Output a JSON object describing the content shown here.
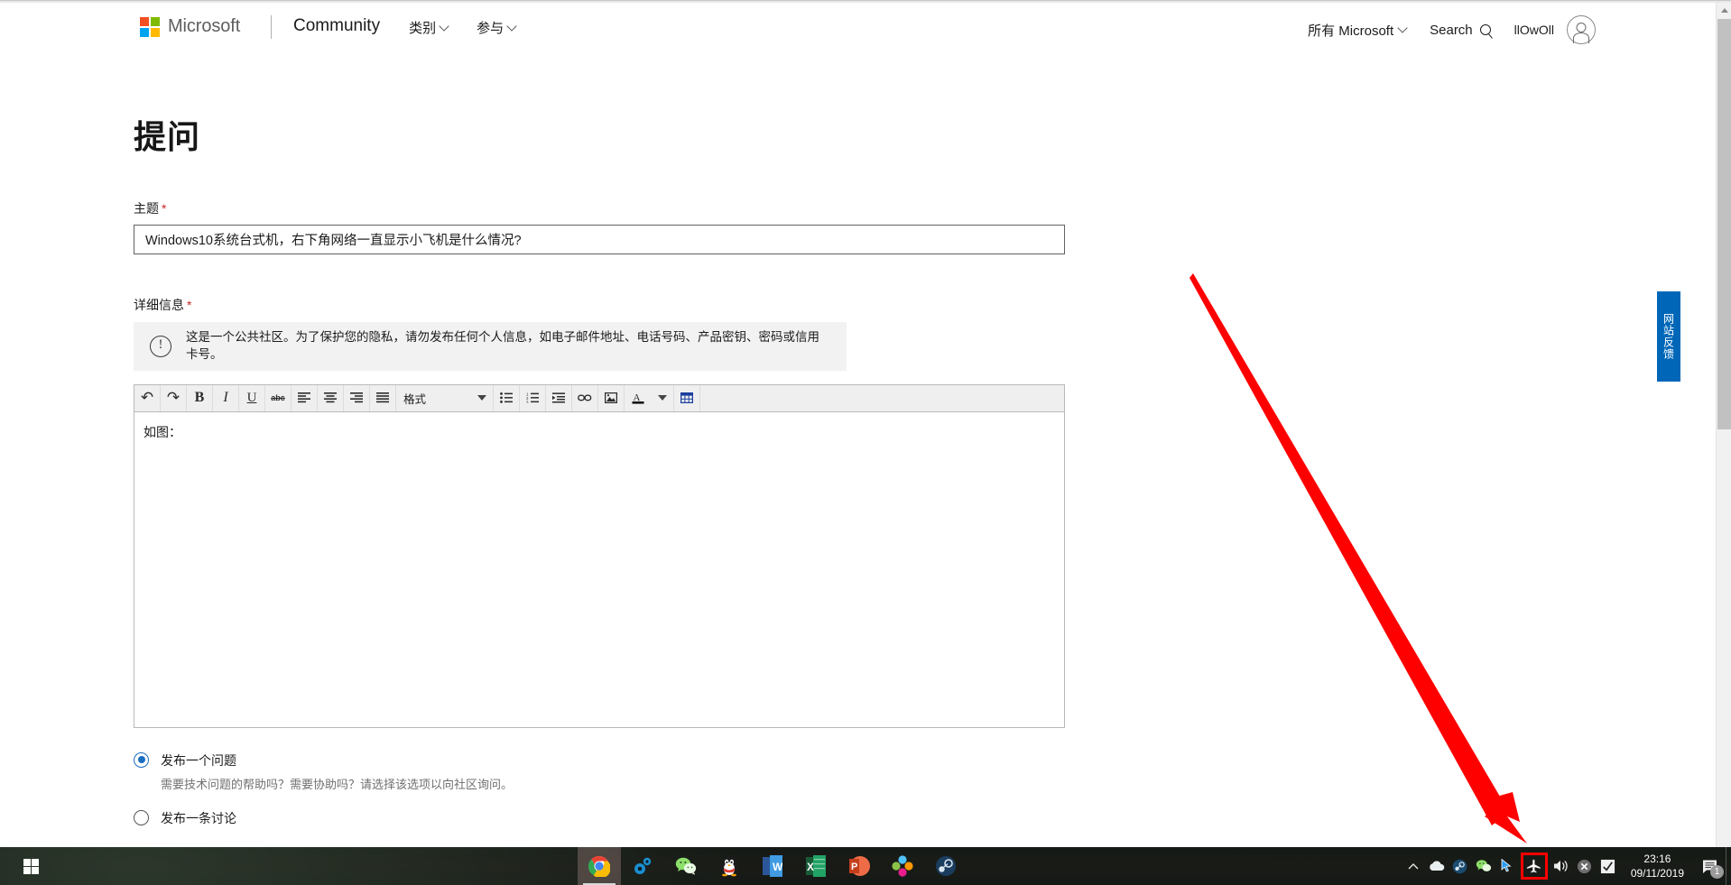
{
  "header": {
    "brand": "Microsoft",
    "site": "Community",
    "nav": [
      {
        "label": "类别",
        "icon": "chevron-down-icon"
      },
      {
        "label": "参与",
        "icon": "chevron-down-icon"
      }
    ],
    "all_microsoft": "所有 Microsoft",
    "search_label": "Search",
    "username": "llOwOll"
  },
  "main": {
    "page_title": "提问",
    "subject": {
      "label": "主题",
      "required_mark": "*",
      "value": "Windows10系统台式机，右下角网络一直显示小飞机是什么情况?"
    },
    "details": {
      "label": "详细信息",
      "required_mark": "*",
      "notice": "这是一个公共社区。为了保护您的隐私，请勿发布任何个人信息，如电子邮件地址、电话号码、产品密钥、密码或信用卡号。",
      "editor_content": "如图："
    },
    "toolbar": {
      "format_label": "格式",
      "buttons": [
        {
          "name": "undo-icon",
          "glyph": "↺"
        },
        {
          "name": "redo-icon",
          "glyph": "↻"
        },
        {
          "name": "bold-icon",
          "glyph": "B"
        },
        {
          "name": "italic-icon",
          "glyph": "I"
        },
        {
          "name": "underline-icon",
          "glyph": "U"
        },
        {
          "name": "strikethrough-icon",
          "glyph": "abc"
        },
        {
          "name": "align-left-icon",
          "glyph": "≡"
        },
        {
          "name": "align-center-icon",
          "glyph": "≡"
        },
        {
          "name": "align-right-icon",
          "glyph": "≡"
        },
        {
          "name": "align-justify-icon",
          "glyph": "≡"
        },
        {
          "name": "bulleted-list-icon",
          "glyph": "•≡"
        },
        {
          "name": "numbered-list-icon",
          "glyph": "1≡"
        },
        {
          "name": "indent-icon",
          "glyph": "→≡"
        },
        {
          "name": "link-icon",
          "glyph": "∞"
        },
        {
          "name": "image-icon",
          "glyph": "▣"
        },
        {
          "name": "font-color-icon",
          "glyph": "A"
        },
        {
          "name": "font-color-dropdown-icon",
          "glyph": "▾"
        },
        {
          "name": "table-icon",
          "glyph": "▦"
        }
      ]
    },
    "post_options": [
      {
        "label": "发布一个问题",
        "description": "需要技术问题的帮助吗？需要协助吗？请选择该选项以向社区询问。",
        "selected": true
      },
      {
        "label": "发布一条讨论",
        "description": "",
        "selected": false
      }
    ]
  },
  "feedback_tab": {
    "label": "网站反馈",
    "color": "#0067b8"
  },
  "annotation": {
    "arrow_color": "#ff0000",
    "highlight_box_color": "#ff0000",
    "highlight_target": "airplane-mode-tray-icon"
  },
  "taskbar": {
    "start": "start-button",
    "apps": [
      {
        "name": "chrome",
        "active": true
      },
      {
        "name": "gears-tool",
        "active": false
      },
      {
        "name": "wechat",
        "active": false
      },
      {
        "name": "qq-penguin",
        "active": false
      },
      {
        "name": "word",
        "active": false
      },
      {
        "name": "excel",
        "active": false
      },
      {
        "name": "powerpoint",
        "active": false
      },
      {
        "name": "color-petals-app",
        "active": false
      },
      {
        "name": "steam",
        "active": false
      }
    ],
    "tray": [
      {
        "name": "show-hidden-icons-chevron"
      },
      {
        "name": "onedrive-cloud"
      },
      {
        "name": "steam-tray"
      },
      {
        "name": "wechat-tray"
      },
      {
        "name": "cursor-tray"
      },
      {
        "name": "airplane-mode",
        "highlighted": true
      },
      {
        "name": "volume"
      },
      {
        "name": "error-x"
      },
      {
        "name": "check-tray"
      }
    ],
    "time": "23:16",
    "date": "09/11/2019",
    "notification_count": "1"
  }
}
